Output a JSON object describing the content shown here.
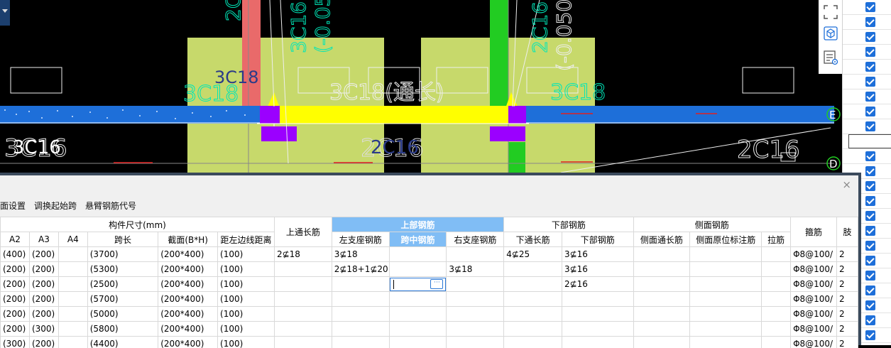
{
  "cad": {
    "labels": {
      "left_top": "3C18",
      "left_top_faint": "3C18",
      "left_bottom": "3C16",
      "left_bottom_faint": "3C16",
      "mid_bottom": "2C16",
      "mid_bottom_faint": "2C16",
      "mid_top_faint": "3C18(通长)",
      "right_top_faint": "3C18",
      "right_bottom_faint": "2C16",
      "vert_left_1": "3C16",
      "vert_left_2": "(-0.05",
      "vert_right_1": "2C16",
      "vert_right_2": "(-0.050)",
      "vert_top_left": "2C"
    },
    "axes": {
      "e": "E",
      "d": "D"
    },
    "tools": {
      "fullscreen_icon": "fullscreen-icon",
      "cube_icon": "cube-view-icon",
      "list_icon": "list-view-icon"
    },
    "colors": {
      "beam": "#1e6fd9",
      "highlight": "#ffff00",
      "column": "#c7d96b",
      "red_bar": "#e96a6a",
      "green_bar": "#22cc22",
      "support": "#9b00ff",
      "text_cyan": "#00e6b8"
    }
  },
  "panel": {
    "close": "×",
    "toolbar": [
      "面设置",
      "调换起始跨",
      "悬臂钢筋代号"
    ],
    "groups": {
      "size": "构件尺寸(mm)",
      "top_long": "上通长筋",
      "upper": "上部钢筋",
      "lower": "下部钢筋",
      "side": "侧面钢筋",
      "stirrup": "箍筋",
      "extra": "肢"
    },
    "columns": [
      "A2",
      "A3",
      "A4",
      "跨长",
      "截面(B*H)",
      "距左边线距离",
      "左支座钢筋",
      "跨中钢筋",
      "右支座钢筋",
      "下通长筋",
      "下部钢筋",
      "侧面通长筋",
      "侧面原位标注筋",
      "拉筋"
    ],
    "rows": [
      {
        "a2": "(400)",
        "a3": "(200)",
        "a4": "",
        "span": "(3700)",
        "sec": "(200*400)",
        "dist": "(100)",
        "top": "2⊈18",
        "left": "3⊈18",
        "mid": "",
        "right": "",
        "btm_long": "4⊈25",
        "btm": "3⊈16",
        "side_long": "",
        "side_mark": "",
        "tie": "",
        "stir": "Φ8@100/",
        "leg": "2"
      },
      {
        "a2": "(200)",
        "a3": "(200)",
        "a4": "",
        "span": "(5300)",
        "sec": "(200*400)",
        "dist": "(100)",
        "top": "",
        "left": "2⊈18+1⊈20",
        "mid": "",
        "right": "3⊈18",
        "btm_long": "",
        "btm": "3⊈16",
        "side_long": "",
        "side_mark": "",
        "tie": "",
        "stir": "Φ8@100/",
        "leg": "2"
      },
      {
        "a2": "(200)",
        "a3": "(200)",
        "a4": "",
        "span": "(2500)",
        "sec": "(200*400)",
        "dist": "(100)",
        "top": "",
        "left": "",
        "mid": "",
        "right": "",
        "btm_long": "",
        "btm": "2⊈16",
        "side_long": "",
        "side_mark": "",
        "tie": "",
        "stir": "Φ8@100/",
        "leg": "2"
      },
      {
        "a2": "(200)",
        "a3": "(200)",
        "a4": "",
        "span": "(5700)",
        "sec": "(200*400)",
        "dist": "(100)",
        "top": "",
        "left": "",
        "mid": "",
        "right": "",
        "btm_long": "",
        "btm": "",
        "side_long": "",
        "side_mark": "",
        "tie": "",
        "stir": "Φ8@100/",
        "leg": "2"
      },
      {
        "a2": "(200)",
        "a3": "(200)",
        "a4": "",
        "span": "(5000)",
        "sec": "(200*400)",
        "dist": "(100)",
        "top": "",
        "left": "",
        "mid": "",
        "right": "",
        "btm_long": "",
        "btm": "",
        "side_long": "",
        "side_mark": "",
        "tie": "",
        "stir": "Φ8@100/",
        "leg": "2"
      },
      {
        "a2": "(200)",
        "a3": "(300)",
        "a4": "",
        "span": "(5800)",
        "sec": "(200*400)",
        "dist": "(100)",
        "top": "",
        "left": "",
        "mid": "",
        "right": "",
        "btm_long": "",
        "btm": "",
        "side_long": "",
        "side_mark": "",
        "tie": "",
        "stir": "Φ8@100/",
        "leg": "2"
      },
      {
        "a2": "(300)",
        "a3": "(200)",
        "a4": "",
        "span": "(4400)",
        "sec": "(200*400)",
        "dist": "(100)",
        "top": "",
        "left": "",
        "mid": "",
        "right": "",
        "btm_long": "",
        "btm": "",
        "side_long": "",
        "side_mark": "",
        "tie": "",
        "stir": "Φ8@100/",
        "leg": "2"
      }
    ],
    "edit_button": "···"
  }
}
